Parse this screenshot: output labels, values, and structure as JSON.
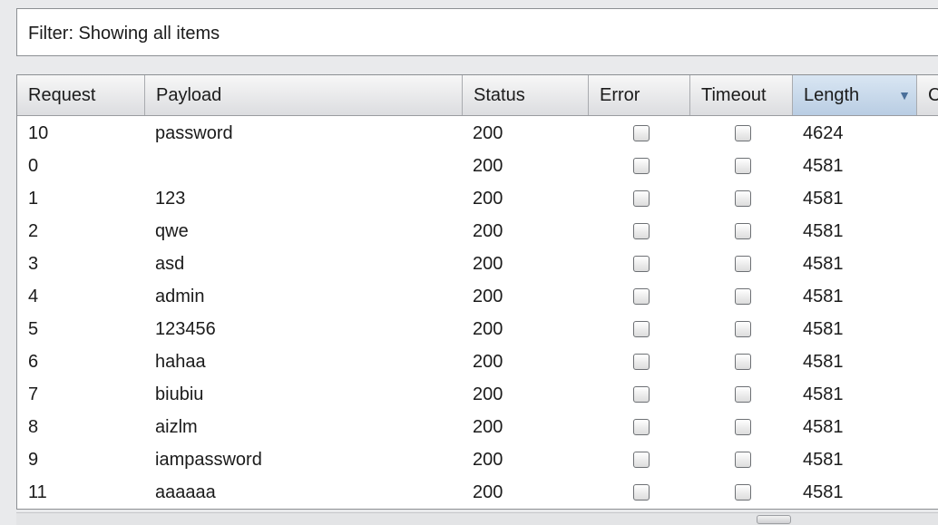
{
  "filter": {
    "label": "Filter:  Showing all items"
  },
  "columns": [
    {
      "label": "Request"
    },
    {
      "label": "Payload"
    },
    {
      "label": "Status"
    },
    {
      "label": "Error"
    },
    {
      "label": "Timeout"
    },
    {
      "label": "Length",
      "sorted": "descending"
    },
    {
      "label": "C"
    }
  ],
  "rows": [
    {
      "request": "10",
      "payload": "password",
      "status": "200",
      "error": false,
      "timeout": false,
      "length": "4624"
    },
    {
      "request": "0",
      "payload": "",
      "status": "200",
      "error": false,
      "timeout": false,
      "length": "4581"
    },
    {
      "request": "1",
      "payload": "123",
      "status": "200",
      "error": false,
      "timeout": false,
      "length": "4581"
    },
    {
      "request": "2",
      "payload": "qwe",
      "status": "200",
      "error": false,
      "timeout": false,
      "length": "4581"
    },
    {
      "request": "3",
      "payload": "asd",
      "status": "200",
      "error": false,
      "timeout": false,
      "length": "4581"
    },
    {
      "request": "4",
      "payload": "admin",
      "status": "200",
      "error": false,
      "timeout": false,
      "length": "4581"
    },
    {
      "request": "5",
      "payload": "123456",
      "status": "200",
      "error": false,
      "timeout": false,
      "length": "4581"
    },
    {
      "request": "6",
      "payload": "hahaa",
      "status": "200",
      "error": false,
      "timeout": false,
      "length": "4581"
    },
    {
      "request": "7",
      "payload": "biubiu",
      "status": "200",
      "error": false,
      "timeout": false,
      "length": "4581"
    },
    {
      "request": "8",
      "payload": "aizlm",
      "status": "200",
      "error": false,
      "timeout": false,
      "length": "4581"
    },
    {
      "request": "9",
      "payload": "iampassword",
      "status": "200",
      "error": false,
      "timeout": false,
      "length": "4581"
    },
    {
      "request": "11",
      "payload": "aaaaaa",
      "status": "200",
      "error": false,
      "timeout": false,
      "length": "4581"
    }
  ],
  "icons": {
    "sort": "sort-descending-icon"
  }
}
